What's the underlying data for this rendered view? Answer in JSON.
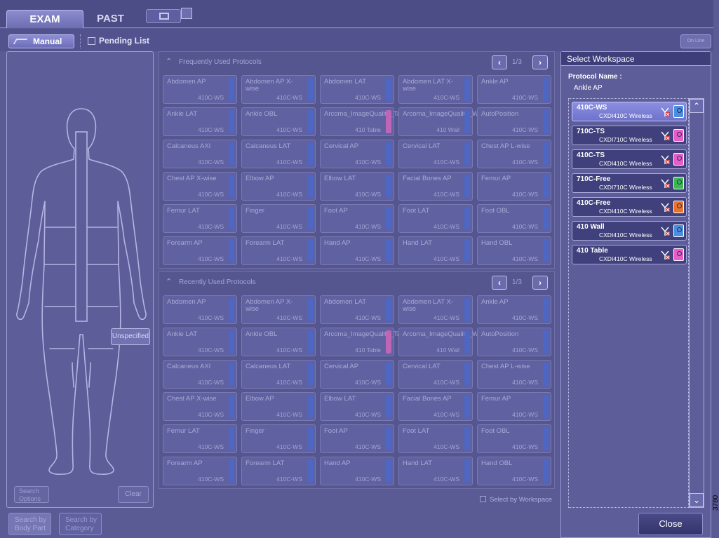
{
  "tabs": {
    "exam": "EXAM",
    "past": "PAST"
  },
  "subbar": {
    "manual": "Manual",
    "pending": "Pending List",
    "online": "On Line"
  },
  "left": {
    "unspecified": "Unspecified",
    "search_options": "Search Options",
    "clear": "Clear",
    "search_body_part": "Search by Body Part",
    "search_category": "Search by Category"
  },
  "sections": {
    "frequent": {
      "title": "Frequently Used Protocols",
      "page": "1/3"
    },
    "recent": {
      "title": "Recently Used Protocols",
      "page": "1/3"
    }
  },
  "protocols": [
    {
      "name": "Abdomen AP",
      "ws": "410C-WS",
      "color": "#4e66c4"
    },
    {
      "name": "Abdomen AP X-wise",
      "ws": "410C-WS",
      "color": "#4e66c4"
    },
    {
      "name": "Abdomen LAT",
      "ws": "410C-WS",
      "color": "#4e66c4"
    },
    {
      "name": "Abdomen LAT X-wise",
      "ws": "410C-WS",
      "color": "#4e66c4"
    },
    {
      "name": "Ankle AP",
      "ws": "410C-WS",
      "color": "#4e66c4"
    },
    {
      "name": "Ankle LAT",
      "ws": "410C-WS",
      "color": "#4e66c4"
    },
    {
      "name": "Ankle OBL",
      "ws": "410C-WS",
      "color": "#4e66c4"
    },
    {
      "name": "Arcoma_ImageQuality_Table",
      "ws": "410 Table",
      "color": "#c064b8"
    },
    {
      "name": "Arcoma_ImageQuality_Wall",
      "ws": "410 Wall",
      "color": "#4e66c4"
    },
    {
      "name": "AutoPosition",
      "ws": "410C-WS",
      "color": "#4e66c4"
    },
    {
      "name": "Calcaneus AXI",
      "ws": "410C-WS",
      "color": "#4e66c4"
    },
    {
      "name": "Calcaneus LAT",
      "ws": "410C-WS",
      "color": "#4e66c4"
    },
    {
      "name": "Cervical AP",
      "ws": "410C-WS",
      "color": "#4e66c4"
    },
    {
      "name": "Cervical LAT",
      "ws": "410C-WS",
      "color": "#4e66c4"
    },
    {
      "name": "Chest AP L-wise",
      "ws": "410C-WS",
      "color": "#4e66c4"
    },
    {
      "name": "Chest AP X-wise",
      "ws": "410C-WS",
      "color": "#4e66c4"
    },
    {
      "name": "Elbow AP",
      "ws": "410C-WS",
      "color": "#4e66c4"
    },
    {
      "name": "Elbow LAT",
      "ws": "410C-WS",
      "color": "#4e66c4"
    },
    {
      "name": "Facial Bones AP",
      "ws": "410C-WS",
      "color": "#4e66c4"
    },
    {
      "name": "Femur AP",
      "ws": "410C-WS",
      "color": "#4e66c4"
    },
    {
      "name": "Femur LAT",
      "ws": "410C-WS",
      "color": "#4e66c4"
    },
    {
      "name": "Finger",
      "ws": "410C-WS",
      "color": "#4e66c4"
    },
    {
      "name": "Foot AP",
      "ws": "410C-WS",
      "color": "#4e66c4"
    },
    {
      "name": "Foot LAT",
      "ws": "410C-WS",
      "color": "#4e66c4"
    },
    {
      "name": "Foot OBL",
      "ws": "410C-WS",
      "color": "#4e66c4"
    },
    {
      "name": "Forearm AP",
      "ws": "410C-WS",
      "color": "#4e66c4"
    },
    {
      "name": "Forearm LAT",
      "ws": "410C-WS",
      "color": "#4e66c4"
    },
    {
      "name": "Hand AP",
      "ws": "410C-WS",
      "color": "#4e66c4"
    },
    {
      "name": "Hand LAT",
      "ws": "410C-WS",
      "color": "#4e66c4"
    },
    {
      "name": "Hand OBL",
      "ws": "410C-WS",
      "color": "#4e66c4"
    }
  ],
  "select_by_workspace": "Select by Workspace",
  "workspace": {
    "header": "Select Workspace",
    "protocol_label": "Protocol Name :",
    "protocol_value": "Ankle AP",
    "items": [
      {
        "name": "410C-WS",
        "sub": "CXDI410C Wireless",
        "icon": "#4a8ee0",
        "selected": true
      },
      {
        "name": "710C-TS",
        "sub": "CXDI710C Wireless",
        "icon": "#e85cc8",
        "selected": false
      },
      {
        "name": "410C-TS",
        "sub": "CXDI410C Wireless",
        "icon": "#e85cc8",
        "selected": false
      },
      {
        "name": "710C-Free",
        "sub": "CXDI710C Wireless",
        "icon": "#3cb850",
        "selected": false
      },
      {
        "name": "410C-Free",
        "sub": "CXDI410C Wireless",
        "icon": "#e8742c",
        "selected": false
      },
      {
        "name": "410 Wall",
        "sub": "CXDI410C Wireless",
        "icon": "#4a8ee0",
        "selected": false
      },
      {
        "name": "410 Table",
        "sub": "CXDI410C Wireless",
        "icon": "#e85cc8",
        "selected": false
      }
    ],
    "close": "Close"
  },
  "side_number": "3780"
}
